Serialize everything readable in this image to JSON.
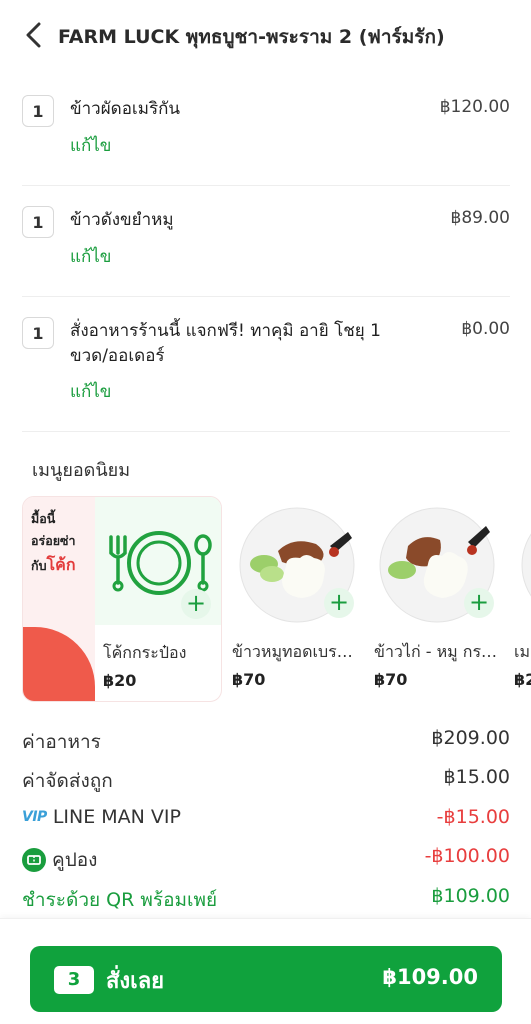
{
  "header": {
    "title": "FARM LUCK พุทธบูชา-พระราม 2 (ฟาร์มรัก)"
  },
  "items": [
    {
      "qty": "1",
      "name": "ข้าวผัดอเมริกัน",
      "price": "฿120.00",
      "edit": "แก้ไข"
    },
    {
      "qty": "1",
      "name": "ข้าวดังขยำหมู",
      "price": "฿89.00",
      "edit": "แก้ไข"
    },
    {
      "qty": "1",
      "name": "สั่งอาหารร้านนี้ แจกฟรี! ทาคุมิ อายิ โชยุ 1 ขวด/ออเดอร์",
      "price": "฿0.00",
      "edit": "แก้ไข"
    }
  ],
  "popular": {
    "title": "เมนูยอดนิยม",
    "promo": {
      "line1": "มื้อนี้",
      "line2": "อร่อยซ่า",
      "line3": "กับ",
      "brand": "โค้ก"
    },
    "cards": [
      {
        "name": "โค้กกระป๋อง",
        "price": "฿20"
      },
      {
        "name": "ข้าวหมูทอดเบรฯ...",
        "price": "฿70"
      },
      {
        "name": "ข้าวไก่ - หมู กระ...",
        "price": "฿70"
      },
      {
        "name": "เม",
        "price": "฿2"
      }
    ]
  },
  "summary": {
    "food_label": "ค่าอาหาร",
    "food_value": "฿209.00",
    "delivery_label": "ค่าจัดส่งถูก",
    "delivery_value": "฿15.00",
    "vip_badge": "VIP",
    "vip_label": "LINE MAN VIP",
    "vip_value": "-฿15.00",
    "coupon_label": "คูปอง",
    "coupon_value": "-฿100.00",
    "payment_label": "ชำระด้วย QR พร้อมเพย์",
    "payment_value": "฿109.00"
  },
  "order_button": {
    "count": "3",
    "label": "สั่งเลย",
    "total": "฿109.00"
  },
  "colors": {
    "brand_green": "#10a23d",
    "discount_red": "#e83e3e",
    "vip_blue": "#3aa0d8"
  }
}
